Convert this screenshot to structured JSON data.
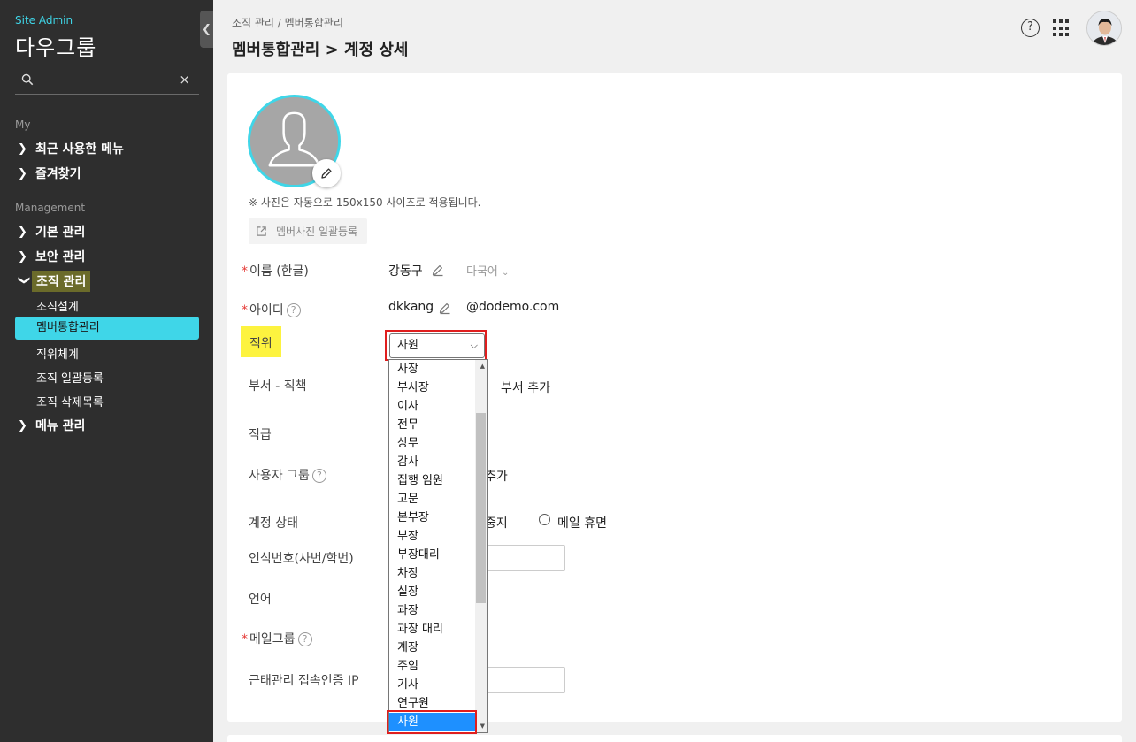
{
  "sidebar": {
    "site_admin": "Site Admin",
    "org_name": "다우그룹",
    "search_clear": "×",
    "section_my": "My",
    "my_items": [
      "최근 사용한 메뉴",
      "즐겨찾기"
    ],
    "section_management": "Management",
    "mgmt_items": [
      "기본 관리",
      "보안 관리",
      "조직 관리"
    ],
    "sub_items": [
      "조직설계",
      "멤버통합관리",
      "직위체계",
      "조직 일괄등록",
      "조직 삭제목록"
    ],
    "menu_mgmt": "메뉴 관리",
    "active_sub": "멤버통합관리",
    "accent_color": "#3fd6e8"
  },
  "header": {
    "breadcrumb": "조직 관리 / 멤버통합관리",
    "title": "멤버통합관리 > 계정 상세",
    "help": "?"
  },
  "profile": {
    "photo_note": "※ 사진은 자동으로 150x150 사이즈로 적용됩니다.",
    "bulk_button": "멤버사진 일괄등록"
  },
  "form": {
    "name_label": "이름 (한글)",
    "name_value": "강동구",
    "lang_label": "다국어",
    "id_label": "아이디",
    "id_value": "dkkang",
    "domain": "@dodemo.com",
    "position_label": "직위",
    "position_value": "사원",
    "dept_label": "부서 - 직책",
    "dept_add": "부서 추가",
    "grade_label": "직급",
    "group_label": "사용자 그룹",
    "group_add_suffix": "추가",
    "status_label": "계정 상태",
    "status_stop_suffix": "중지",
    "status_dormant": "메일 휴면",
    "empno_label": "인식번호(사번/학번)",
    "lang2_label": "언어",
    "mailgroup_label": "메일그룹",
    "ip_label": "근태관리 접속인증 IP"
  },
  "dropdown": {
    "options": [
      "사장",
      "부사장",
      "이사",
      "전무",
      "상무",
      "감사",
      "집행 임원",
      "고문",
      "본부장",
      "부장",
      "부장대리",
      "차장",
      "실장",
      "과장",
      "과장 대리",
      "계장",
      "주임",
      "기사",
      "연구원",
      "사원"
    ],
    "selected": "사원"
  }
}
